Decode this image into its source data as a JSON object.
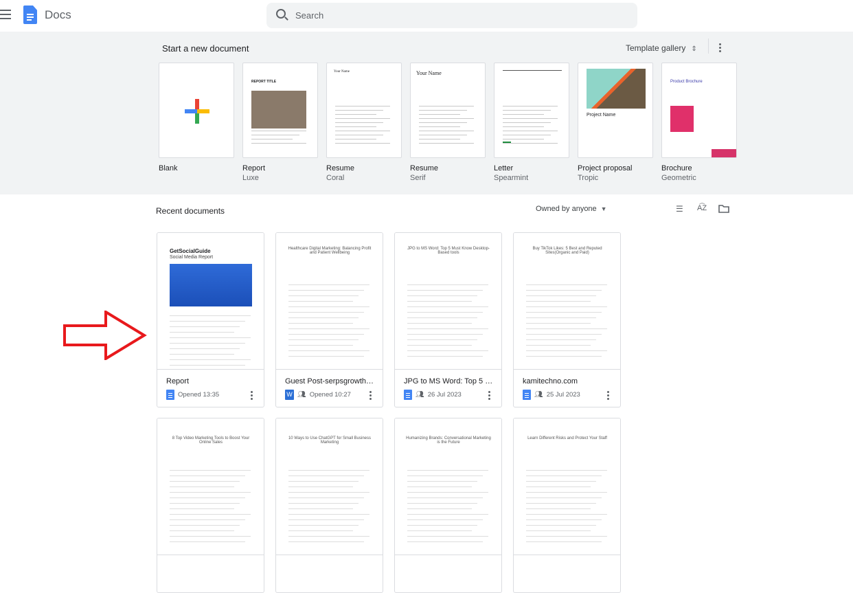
{
  "header": {
    "app_title": "Docs",
    "search_placeholder": "Search",
    "icons": [
      "menu-icon",
      "docs-logo",
      "search-icon"
    ]
  },
  "templates": {
    "heading": "Start a new document",
    "gallery_label": "Template gallery",
    "items": [
      {
        "name": "Blank",
        "sub": ""
      },
      {
        "name": "Report",
        "sub": "Luxe",
        "preview": "REPORT TITLE"
      },
      {
        "name": "Resume",
        "sub": "Coral",
        "preview": "Your Name"
      },
      {
        "name": "Resume",
        "sub": "Serif",
        "preview": "Your Name"
      },
      {
        "name": "Letter",
        "sub": "Spearmint",
        "preview": ""
      },
      {
        "name": "Project proposal",
        "sub": "Tropic",
        "preview": "Project Name"
      },
      {
        "name": "Brochure",
        "sub": "Geometric",
        "preview": "Product Brochure"
      }
    ]
  },
  "recent": {
    "heading": "Recent documents",
    "owner_filter": "Owned by anyone",
    "documents": [
      {
        "title": "Report",
        "meta": "Opened 13:35",
        "type": "docs",
        "shared": false,
        "preview_title": "GetSocialGuide",
        "preview_sub": "Social Media Report"
      },
      {
        "title": "Guest Post-serpsgrowth....",
        "meta": "Opened 10:27",
        "type": "word",
        "shared": true,
        "preview_title": "Healthcare Digital Marketing: Balancing Profit and Patient Wellbeing"
      },
      {
        "title": "JPG to MS Word: Top 5 M...",
        "meta": "26 Jul 2023",
        "type": "docs",
        "shared": true,
        "preview_title": "JPG to MS Word: Top 5 Must Know Desktop-Based tools"
      },
      {
        "title": "kamitechno.com",
        "meta": "25 Jul 2023",
        "type": "docs",
        "shared": true,
        "preview_title": "Buy TikTok Likes: 5 Best and Reputed Sites(Organic and Paid)"
      },
      {
        "preview_title": "8 Top Video Marketing Tools to Boost Your Online Sales"
      },
      {
        "preview_title": "10 Ways to Use ChatGPT for Small Business Marketing"
      },
      {
        "preview_title": "Humanizing Brands: Conversational Marketing is the Future"
      },
      {
        "preview_title": "Learn Different Risks and Protect Your Staff"
      }
    ]
  },
  "annotation": {
    "arrow_color": "#e8191c"
  },
  "colors": {
    "docs_blue": "#4285f4",
    "template_bg": "#f1f3f4"
  }
}
